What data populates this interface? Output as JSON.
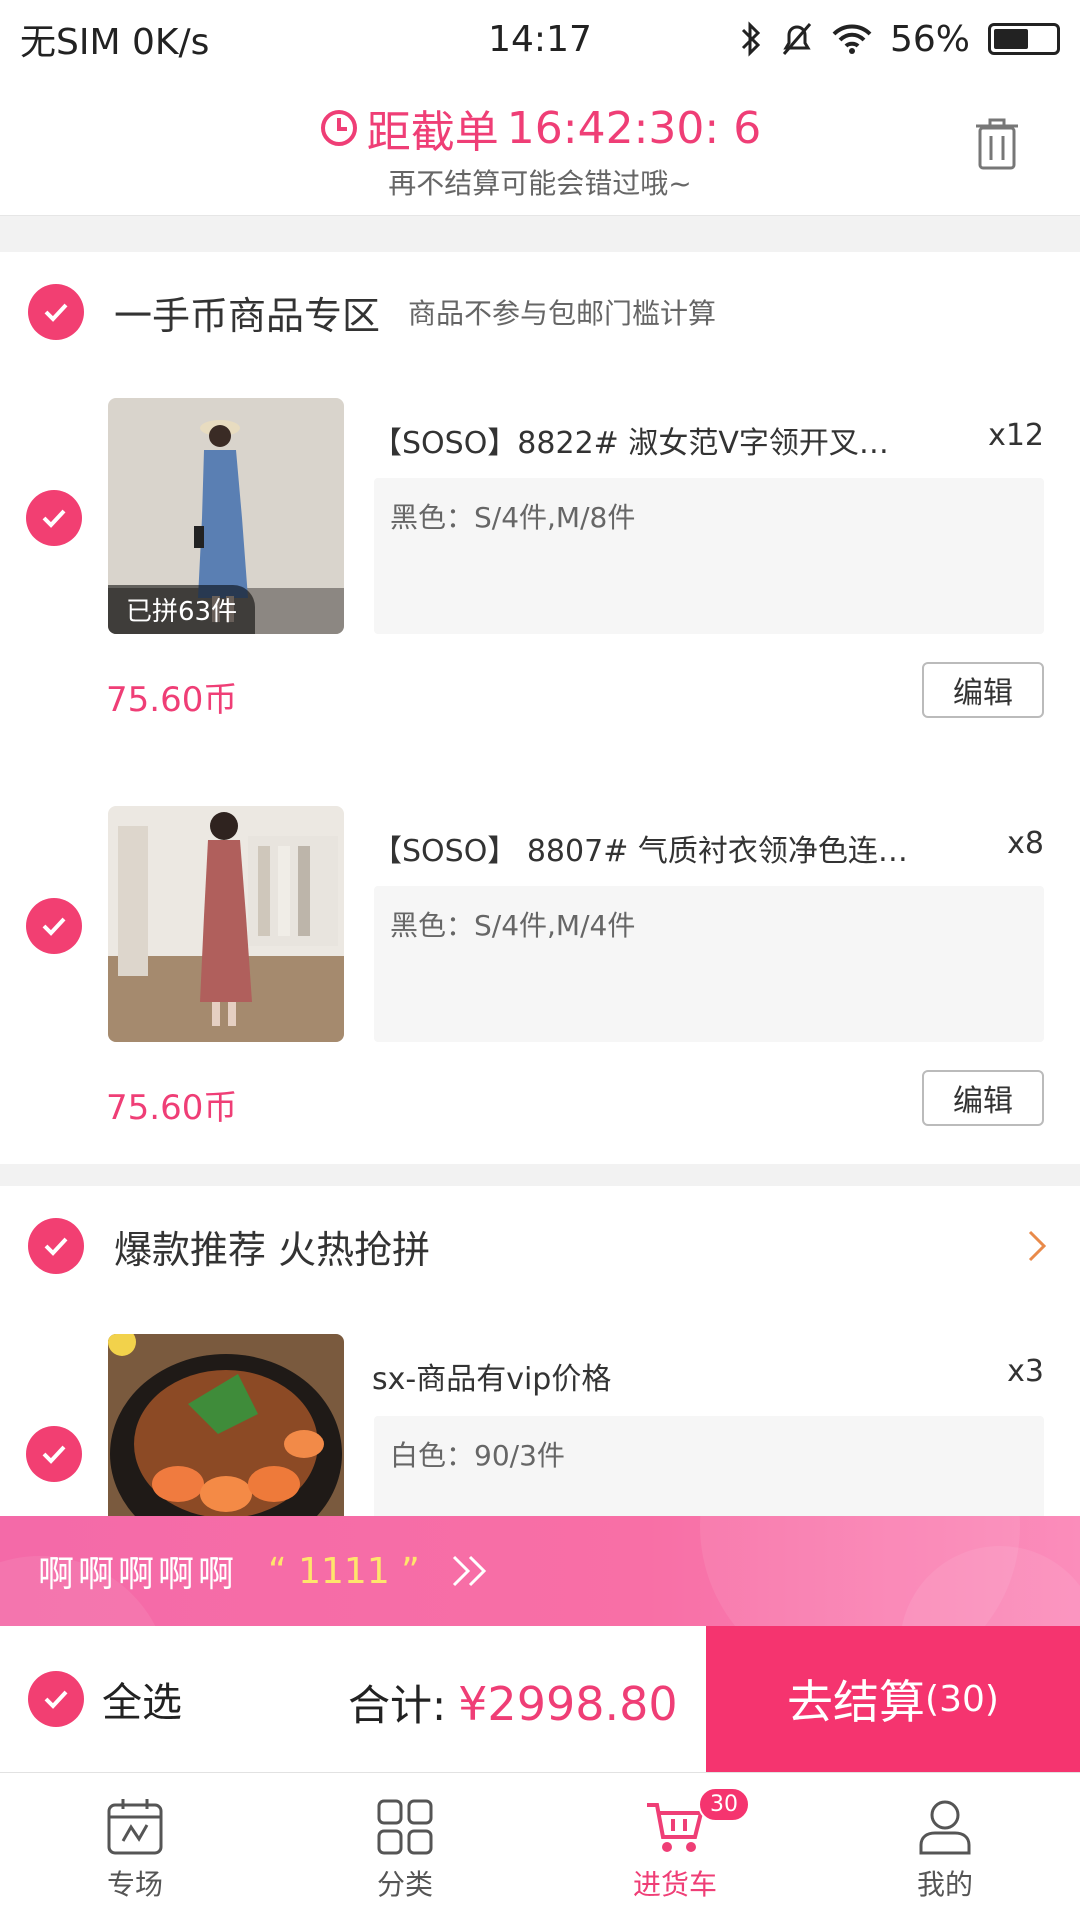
{
  "status_bar": {
    "carrier": "无SIM",
    "speed": "0K/s",
    "time": "14:17",
    "battery": "56%",
    "battery_level": 0.56
  },
  "header": {
    "countdown_label": "距截单",
    "countdown_value": "16:42:30: 6",
    "subtitle": "再不结算可能会错过哦~"
  },
  "sections": [
    {
      "title": "一手币商品专区",
      "note": "商品不参与包邮门槛计算",
      "items": [
        {
          "title": "【SOSO】8822# 淑女范V字领开叉…",
          "qty": "x12",
          "variant": "黑色：S/4件,M/8件",
          "price": "75.60币",
          "badge": "已拼63件",
          "edit_label": "编辑"
        },
        {
          "title": "【SOSO】 8807# 气质衬衣领净色连…",
          "qty": "x8",
          "variant": "黑色：S/4件,M/4件",
          "price": "75.60币",
          "edit_label": "编辑"
        }
      ]
    },
    {
      "title": "爆款推荐 火热抢拼",
      "items": [
        {
          "title": "sx-商品有vip价格",
          "qty": "x3",
          "variant": "白色：90/3件"
        }
      ]
    }
  ],
  "promo": {
    "text": "啊啊啊啊啊",
    "code": "“ 1111 ”"
  },
  "checkout": {
    "select_all_label": "全选",
    "total_label": "合计:",
    "total_amount": "¥2998.80",
    "pay_label": "去结算",
    "pay_count": "(30)"
  },
  "tabbar": {
    "tabs": [
      {
        "label": "专场",
        "icon": "calendar-icon"
      },
      {
        "label": "分类",
        "icon": "grid-icon"
      },
      {
        "label": "进货车",
        "icon": "cart-icon",
        "badge": "30",
        "active": true
      },
      {
        "label": "我的",
        "icon": "user-icon"
      }
    ]
  },
  "colors": {
    "accent": "#ef3e76",
    "pay_button": "#f5346f",
    "promo_code": "#ffe56c"
  }
}
